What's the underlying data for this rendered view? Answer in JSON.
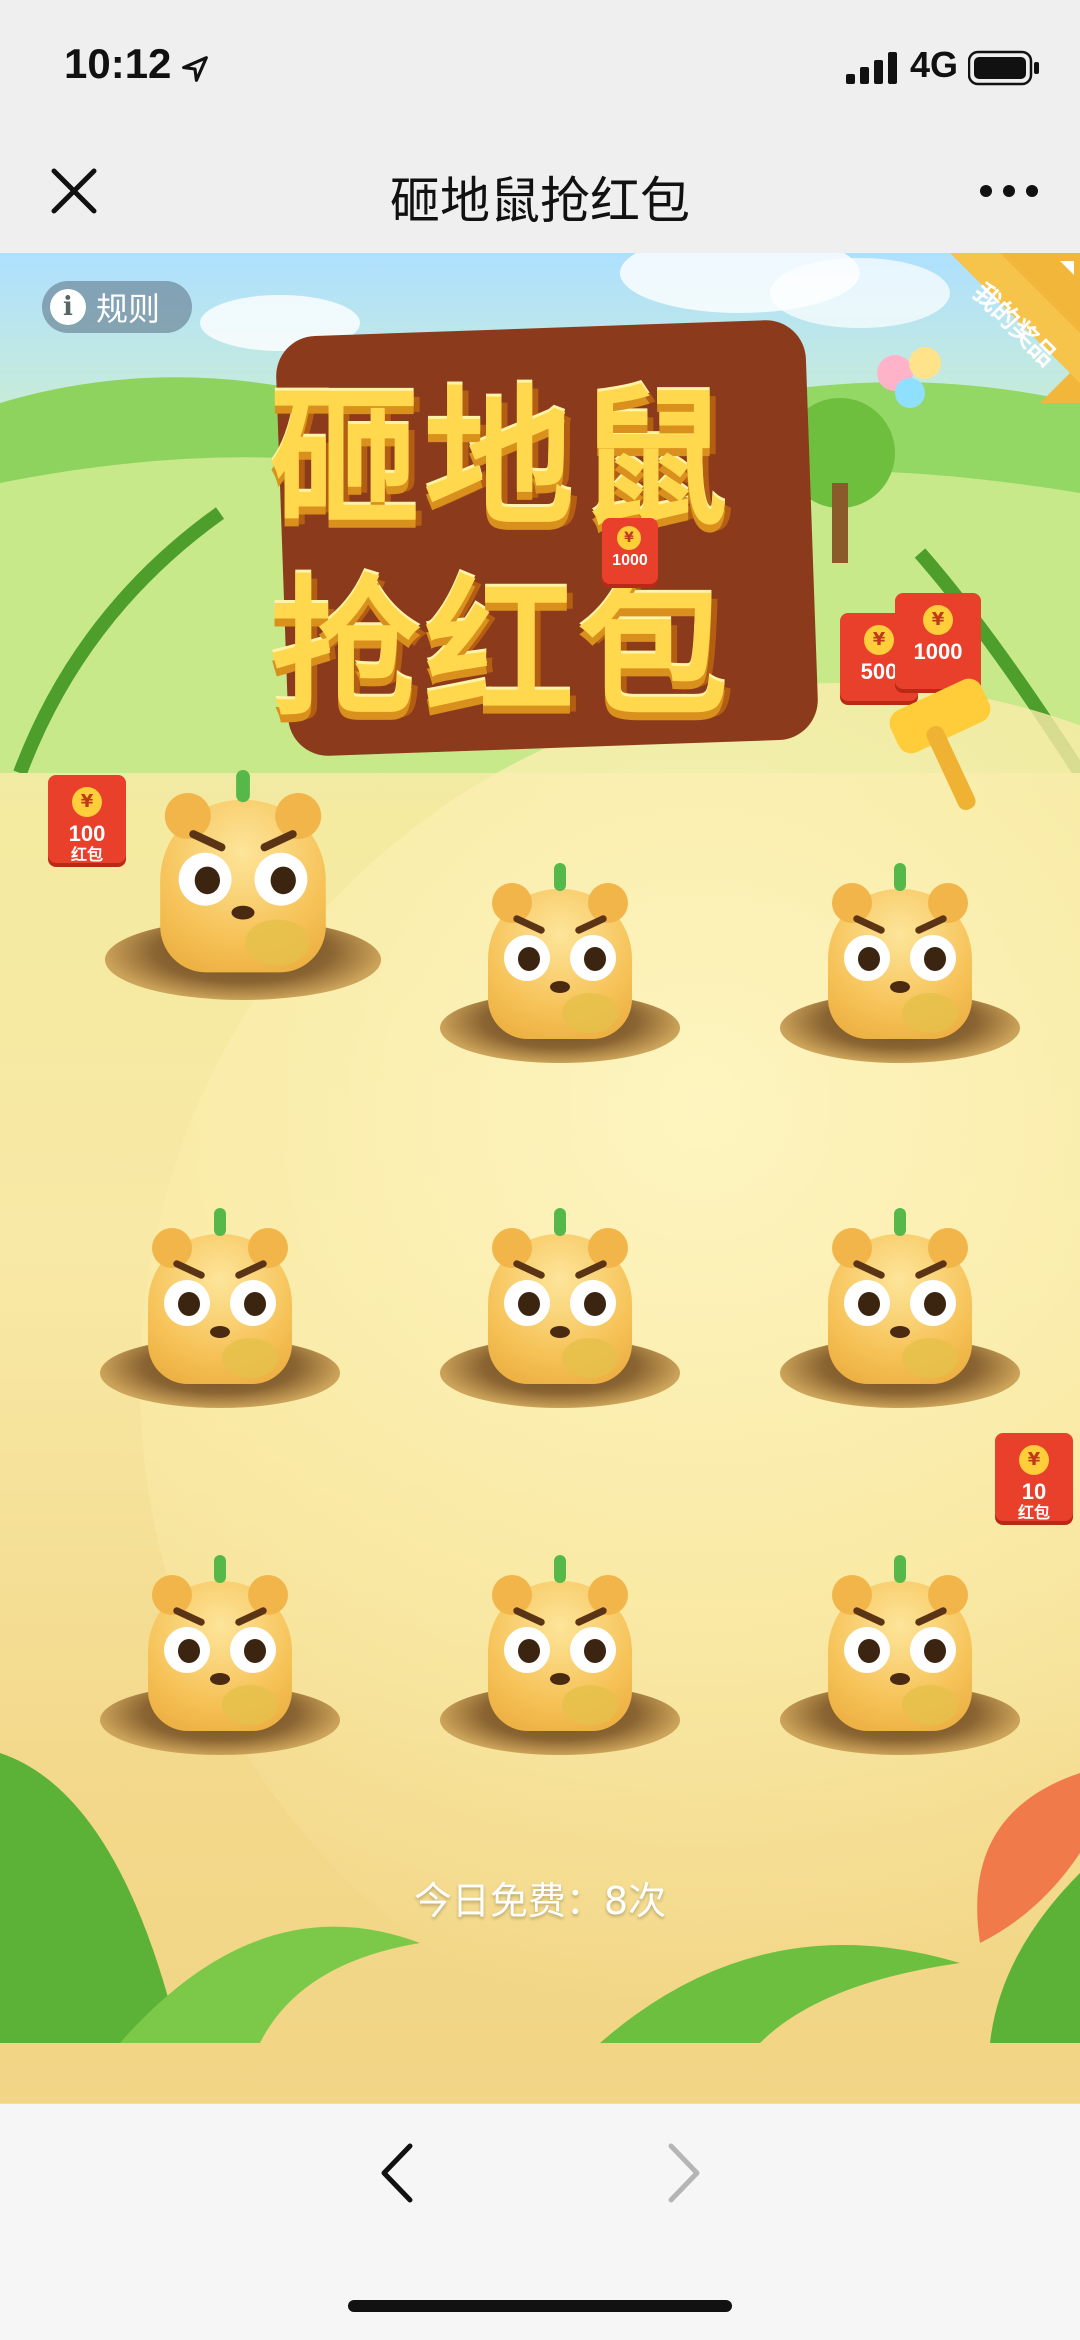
{
  "status_bar": {
    "time": "10:12",
    "network": "4G"
  },
  "nav": {
    "title": "砸地鼠抢红包"
  },
  "game": {
    "rules_label": "规则",
    "my_prize_label": "我的奖品",
    "logo_line1": "砸地鼠",
    "logo_line2": "抢红包",
    "logo_pack_amount": "1000",
    "redpacks": [
      {
        "amount": "100",
        "sub": "红包"
      },
      {
        "amount": "500",
        "sub": ""
      },
      {
        "amount": "1000",
        "sub": ""
      },
      {
        "amount": "10",
        "sub": "红包"
      }
    ],
    "coin_symbol": "¥",
    "free_times": "今日免费：8次"
  },
  "prizes": {
    "tag": "奖品",
    "coin_symbol": "¥",
    "count": 4
  }
}
